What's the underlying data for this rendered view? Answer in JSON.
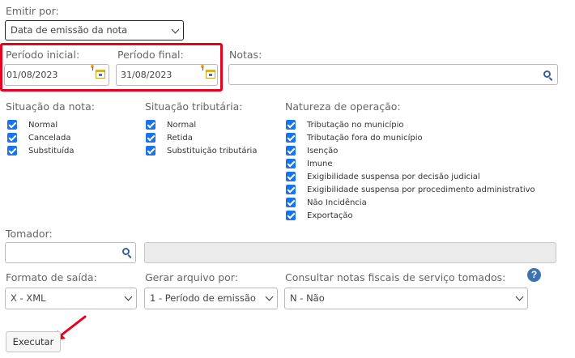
{
  "emitir_por": {
    "label": "Emitir por:",
    "selected": "Data de emissão da nota"
  },
  "periodo_inicial": {
    "label": "Período inicial:",
    "value": "01/08/2023"
  },
  "periodo_final": {
    "label": "Período final:",
    "value": "31/08/2023"
  },
  "notas": {
    "label": "Notas:",
    "value": ""
  },
  "situacao_nota": {
    "label": "Situação da nota:",
    "options": [
      "Normal",
      "Cancelada",
      "Substituída"
    ]
  },
  "situacao_tributaria": {
    "label": "Situação tributária:",
    "options": [
      "Normal",
      "Retida",
      "Substituição tributária"
    ]
  },
  "natureza_operacao": {
    "label": "Natureza de operação:",
    "options": [
      "Tributação no município",
      "Tributação fora do município",
      "Isenção",
      "Imune",
      "Exigibilidade suspensa por decisão judicial",
      "Exigibilidade suspensa por procedimento administrativo",
      "Não Incidência",
      "Exportação"
    ]
  },
  "tomador": {
    "label": "Tomador:",
    "value": "",
    "name_value": ""
  },
  "formato_saida": {
    "label": "Formato de saída:",
    "selected": "X - XML"
  },
  "gerar_arquivo": {
    "label": "Gerar arquivo por:",
    "selected": "1 - Período de emissão"
  },
  "consultar_tomados": {
    "label": "Consultar notas fiscais de serviço tomados:",
    "selected": "N - Não",
    "help": "?"
  },
  "executar": {
    "label": "Executar"
  },
  "colors": {
    "highlight_red": "#e8001c",
    "checkbox_blue": "#1a73e8",
    "help_blue": "#3f72b5"
  }
}
